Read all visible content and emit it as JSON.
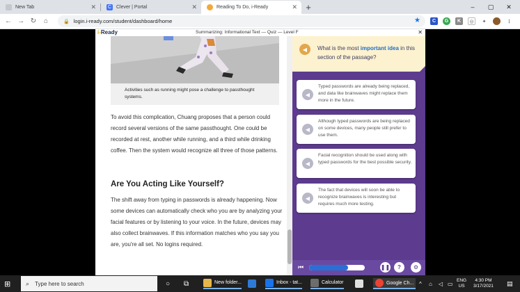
{
  "browser": {
    "tabs": [
      {
        "title": "New Tab",
        "fav_color": "#dee1e6",
        "active": false
      },
      {
        "title": "Clever | Portal",
        "fav_color": "#4274f6",
        "active": false
      },
      {
        "title": "Reading To Do, i-Ready",
        "fav_color": "#f2a93b",
        "active": true
      }
    ],
    "url": "login.i-ready.com/student/dashboard/home",
    "window_controls": [
      "–",
      "▢",
      "✕"
    ]
  },
  "app": {
    "logo_prefix": "i-",
    "logo_name": "Ready",
    "quiz_title": "Summarizing: Informational Text — Quiz — Level F",
    "close_label": "✕"
  },
  "reading": {
    "caption": "Activities such as running might pose a challenge to passthought systems.",
    "paragraph1": "To avoid this complication, Chuang proposes that a person could record several versions of the same passthought. One could be recorded at rest, another while running, and a third while drinking coffee. Then the system would recognize all three of those patterns.",
    "heading": "Are You Acting Like Yourself?",
    "paragraph2": "The shift away from typing in passwords is already happening. Now some devices can automatically check who you are by analyzing your facial features or by listening to your voice. In the future, devices may also collect brainwaves. If this information matches who you say you are, you're all set. No logins required."
  },
  "question": {
    "prefix": "What is the most ",
    "highlight": "important idea",
    "suffix": " in this section of the passage?",
    "options": [
      "Typed passwords are already being replaced, and data like brainwaves might replace them more in the future.",
      "Although typed passwords are being replaced on some devices, many people still prefer to use them.",
      "Facial recognition should be used along with typed passwords for the best possible security.",
      "The fact that devices will soon be able to recognize brainwaves is interesting but requires much more testing."
    ]
  },
  "player": {
    "progress": 0.7,
    "pause_label": "❚❚",
    "help_label": "?",
    "settings_label": "⚙"
  },
  "taskbar": {
    "search_placeholder": "Type here to search",
    "apps": [
      {
        "label": "New folder...",
        "color": "#e6b84a"
      },
      {
        "label": "Inbox - tat...",
        "color": "#1a73e8"
      },
      {
        "label": "Calculator",
        "color": "#6d6d6d"
      },
      {
        "label": "Google Ch...",
        "color": "#ea4335"
      }
    ],
    "lang": "ENG",
    "region": "US",
    "time": "4:30 PM",
    "date": "3/17/2021"
  }
}
